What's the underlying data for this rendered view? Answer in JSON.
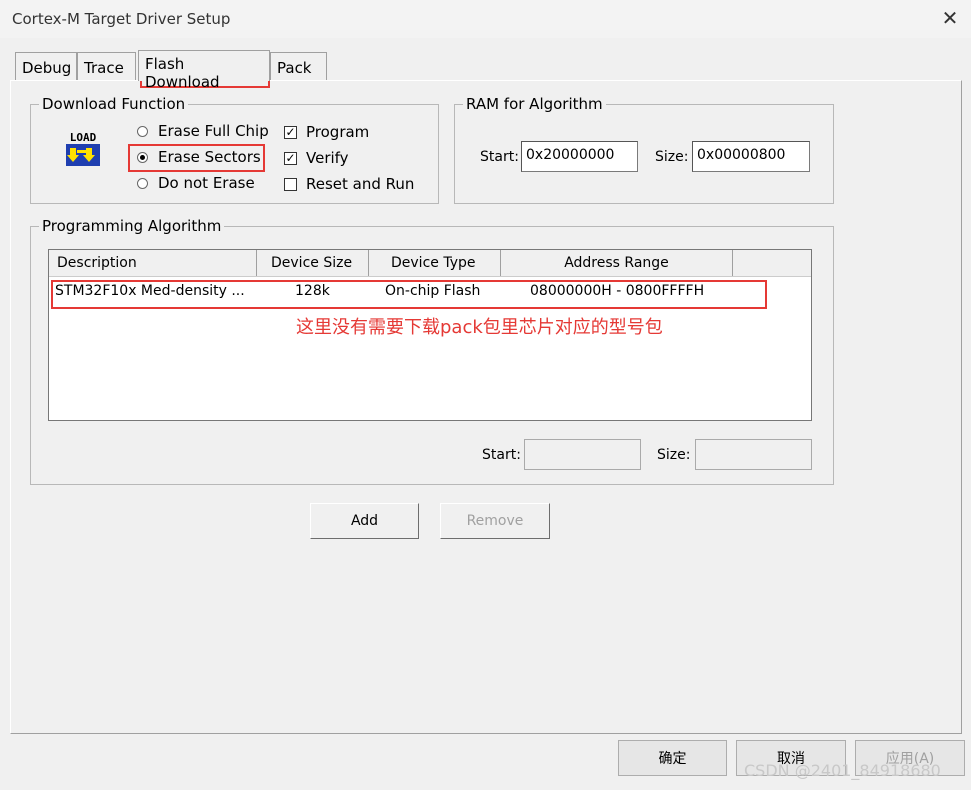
{
  "window": {
    "title": "Cortex-M Target Driver Setup",
    "close_icon": "close-icon"
  },
  "tabs": [
    {
      "label": "Debug",
      "active": false
    },
    {
      "label": "Trace",
      "active": false
    },
    {
      "label": "Flash Download",
      "active": true
    },
    {
      "label": "Pack",
      "active": false
    }
  ],
  "download_function": {
    "legend": "Download Function",
    "icon": "load-icon",
    "icon_text": "LOAD",
    "erase_options": [
      {
        "label": "Erase Full Chip",
        "selected": false
      },
      {
        "label": "Erase Sectors",
        "selected": true
      },
      {
        "label": "Do not Erase",
        "selected": false
      }
    ],
    "checks": [
      {
        "label": "Program",
        "checked": true
      },
      {
        "label": "Verify",
        "checked": true
      },
      {
        "label": "Reset and Run",
        "checked": false
      }
    ]
  },
  "ram_for_algorithm": {
    "legend": "RAM for Algorithm",
    "start_label": "Start:",
    "start_value": "0x20000000",
    "size_label": "Size:",
    "size_value": "0x00000800"
  },
  "programming_algorithm": {
    "legend": "Programming Algorithm",
    "columns": [
      "Description",
      "Device Size",
      "Device Type",
      "Address Range"
    ],
    "rows": [
      {
        "description": "STM32F10x Med-density ...",
        "device_size": "128k",
        "device_type": "On-chip Flash",
        "address_range": "08000000H - 0800FFFFH"
      }
    ],
    "start_label": "Start:",
    "start_value": "",
    "size_label": "Size:",
    "size_value": ""
  },
  "buttons": {
    "add": "Add",
    "remove": "Remove"
  },
  "footer": {
    "ok": "确定",
    "cancel": "取消",
    "apply": "应用(A)"
  },
  "annotation": "这里没有需要下载pack包里芯片对应的型号包",
  "watermark": "CSDN @2401_84918680",
  "colors": {
    "annotation": "#e53935",
    "background": "#f0f0f0"
  }
}
